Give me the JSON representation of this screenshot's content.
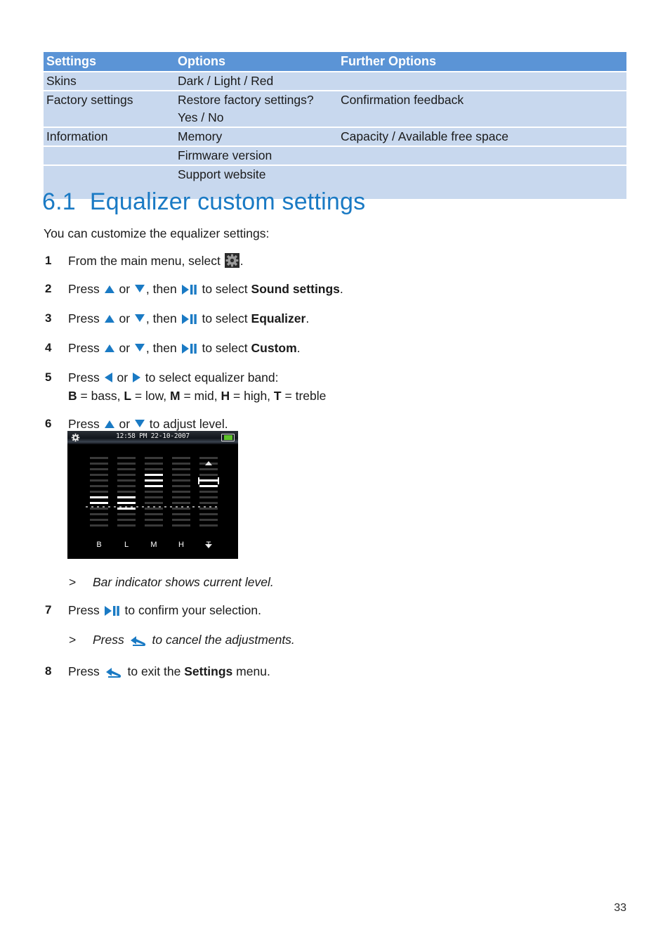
{
  "table": {
    "headers": [
      "Settings",
      "Options",
      "Further Options"
    ],
    "header_bg": "#5b94d6",
    "row_bg": "#c8d8ee",
    "rows": [
      {
        "settings": "Skins",
        "options": "Dark / Light / Red",
        "further": ""
      },
      {
        "settings": "Factory settings",
        "options": "Restore factory settings?",
        "further": "Confirmation feedback"
      },
      {
        "settings": "",
        "options": "Yes / No",
        "further": ""
      },
      {
        "settings": "Information",
        "options": "Memory",
        "further": "Capacity / Available free space"
      },
      {
        "settings": "",
        "options": "Firmware version",
        "further": ""
      },
      {
        "settings": "",
        "options": "Support website",
        "further": ""
      }
    ]
  },
  "heading": {
    "number": "6.1",
    "title": "Equalizer custom settings",
    "color": "#1a7ac4"
  },
  "intro": "You can customize the equalizer settings:",
  "steps": {
    "s1": {
      "num": "1",
      "a": "From the main menu, select",
      "b": "."
    },
    "s2": {
      "num": "2",
      "a": "Press",
      "b": "or",
      "c": ", then",
      "d": "to select",
      "e": "Sound settings",
      "f": "."
    },
    "s3": {
      "num": "3",
      "a": "Press",
      "b": "or",
      "c": ", then",
      "d": "to select",
      "e": "Equalizer",
      "f": "."
    },
    "s4": {
      "num": "4",
      "a": "Press",
      "b": "or",
      "c": ", then",
      "d": "to select",
      "e": "Custom",
      "f": "."
    },
    "s5": {
      "num": "5",
      "a": "Press",
      "b": "or",
      "c": "to select equalizer band:",
      "b_label": "B",
      "b_text": "= bass,",
      "l_label": "L",
      "l_text": "= low,",
      "m_label": "M",
      "m_text": "= mid,",
      "h_label": "H",
      "h_text": "= high,",
      "t_label": "T",
      "t_text": "= treble"
    },
    "s6": {
      "num": "6",
      "a": "Press",
      "b": "or",
      "c": "to adjust level."
    },
    "note1": {
      "gt": ">",
      "text": "Bar indicator shows current level."
    },
    "s7": {
      "num": "7",
      "a": "Press",
      "b": "to confirm your selection."
    },
    "note2": {
      "gt": ">",
      "a": "Press",
      "b": "to cancel the adjustments."
    },
    "s8": {
      "num": "8",
      "a": "Press",
      "b": "to exit the",
      "c": "Settings",
      "d": "menu."
    }
  },
  "device_screen": {
    "status_text": "12:58 PM  22-10-2007",
    "gear_icon": "gear-icon",
    "battery_icon": "battery-icon",
    "battery_color": "#5ec22a",
    "band_labels": [
      "B",
      "L",
      "M",
      "H",
      "T"
    ],
    "selected_band": "T",
    "band_levels": [
      -2,
      -3,
      3,
      0,
      2
    ],
    "total_segments": 13,
    "center_index": 6
  },
  "icons": {
    "gear": "gear-icon",
    "play_pause": "play-pause-icon",
    "arrow_up": "triangle-up-icon",
    "arrow_down": "triangle-down-icon",
    "arrow_left": "triangle-left-icon",
    "arrow_right": "triangle-right-icon",
    "back": "back-arrow-icon"
  },
  "page_number": "33"
}
